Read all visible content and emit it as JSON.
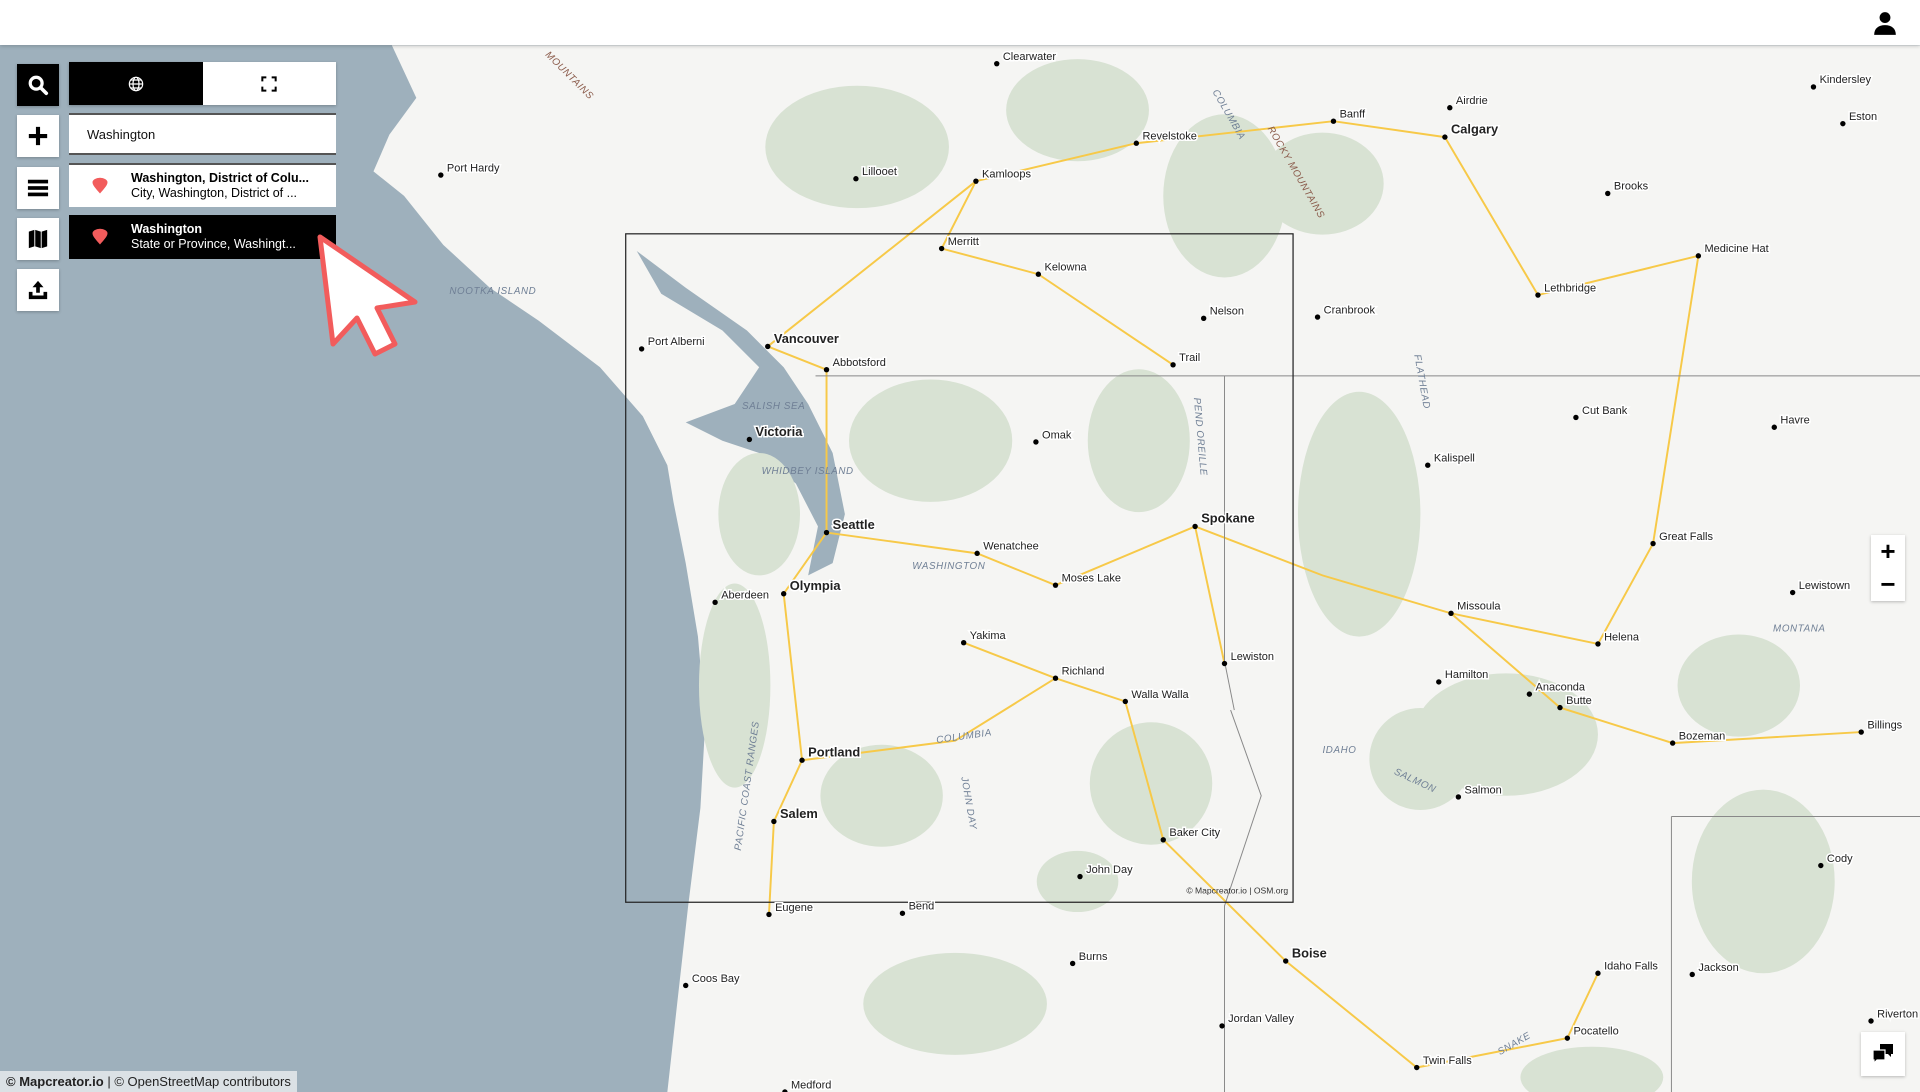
{
  "toolbar": {
    "buttons": [
      {
        "name": "search",
        "icon": "search-icon"
      },
      {
        "name": "add",
        "icon": "plus-icon"
      },
      {
        "name": "layers",
        "icon": "list-icon"
      },
      {
        "name": "map-styles",
        "icon": "map-icon"
      },
      {
        "name": "export",
        "icon": "upload-icon"
      }
    ]
  },
  "search_panel": {
    "tabs": [
      {
        "icon": "globe-icon",
        "active": true
      },
      {
        "icon": "fullscreen-icon",
        "active": false
      }
    ],
    "query": "Washington",
    "results": [
      {
        "title": "Washington, District of Colu...",
        "subtitle": "City, Washington, District of ...",
        "selected": false
      },
      {
        "title": "Washington",
        "subtitle": "State or Province, Washingt...",
        "selected": true
      }
    ]
  },
  "map": {
    "extent_attribution": "© Mapcreator.io | OSM.org",
    "cities": [
      "Clearwater",
      "Banff",
      "Airdrie",
      "Calgary",
      "Kindersley",
      "Eston",
      "Revelstoke",
      "Kamloops",
      "Lillooet",
      "Port Hardy",
      "Brooks",
      "Medicine Hat",
      "Merritt",
      "Kelowna",
      "Lethbridge",
      "Nelson",
      "Cranbrook",
      "Trail",
      "Port Alberni",
      "Vancouver",
      "Abbotsford",
      "Victoria",
      "Omak",
      "Cut Bank",
      "Havre",
      "Kalispell",
      "Seattle",
      "Wenatchee",
      "Spokane",
      "Great Falls",
      "Moses Lake",
      "Lewistown",
      "Aberdeen",
      "Olympia",
      "Missoula",
      "Yakima",
      "Helena",
      "Richland",
      "Lewiston",
      "Hamilton",
      "Anaconda",
      "Walla Walla",
      "Butte",
      "Billings",
      "Bozeman",
      "Portland",
      "Salmon",
      "Salem",
      "Baker City",
      "Cody",
      "John Day",
      "Eugene",
      "Bend",
      "Boise",
      "Burns",
      "Idaho Falls",
      "Jackson",
      "Coos Bay",
      "Riverton",
      "Jordan Valley",
      "Pocatello",
      "Twin Falls",
      "Medford"
    ],
    "regions": [
      "NOOTKA ISLAND",
      "SALISH SEA",
      "WHIDBEY ISLAND",
      "WASHINGTON",
      "IDAHO",
      "MONTANA",
      "COLUMBIA",
      "SALMON",
      "SNAKE",
      "FLATHEAD",
      "JOHN DAY",
      "PACIFIC COAST RANGES",
      "ROCKY MOUNTAINS",
      "COLUMBIA",
      "MOUNTAINS",
      "PEND OREILLE"
    ],
    "colors": {
      "water": "#9eb0bc",
      "land": "#f5f5f3",
      "forest": "#d8e2d3",
      "road": "#f7c948",
      "accent": "#f25c5c"
    }
  },
  "zoom": {
    "in": "+",
    "out": "−"
  },
  "attribution": {
    "brand": "© Mapcreator.io",
    "rest": " | © OpenStreetMap contributors"
  }
}
